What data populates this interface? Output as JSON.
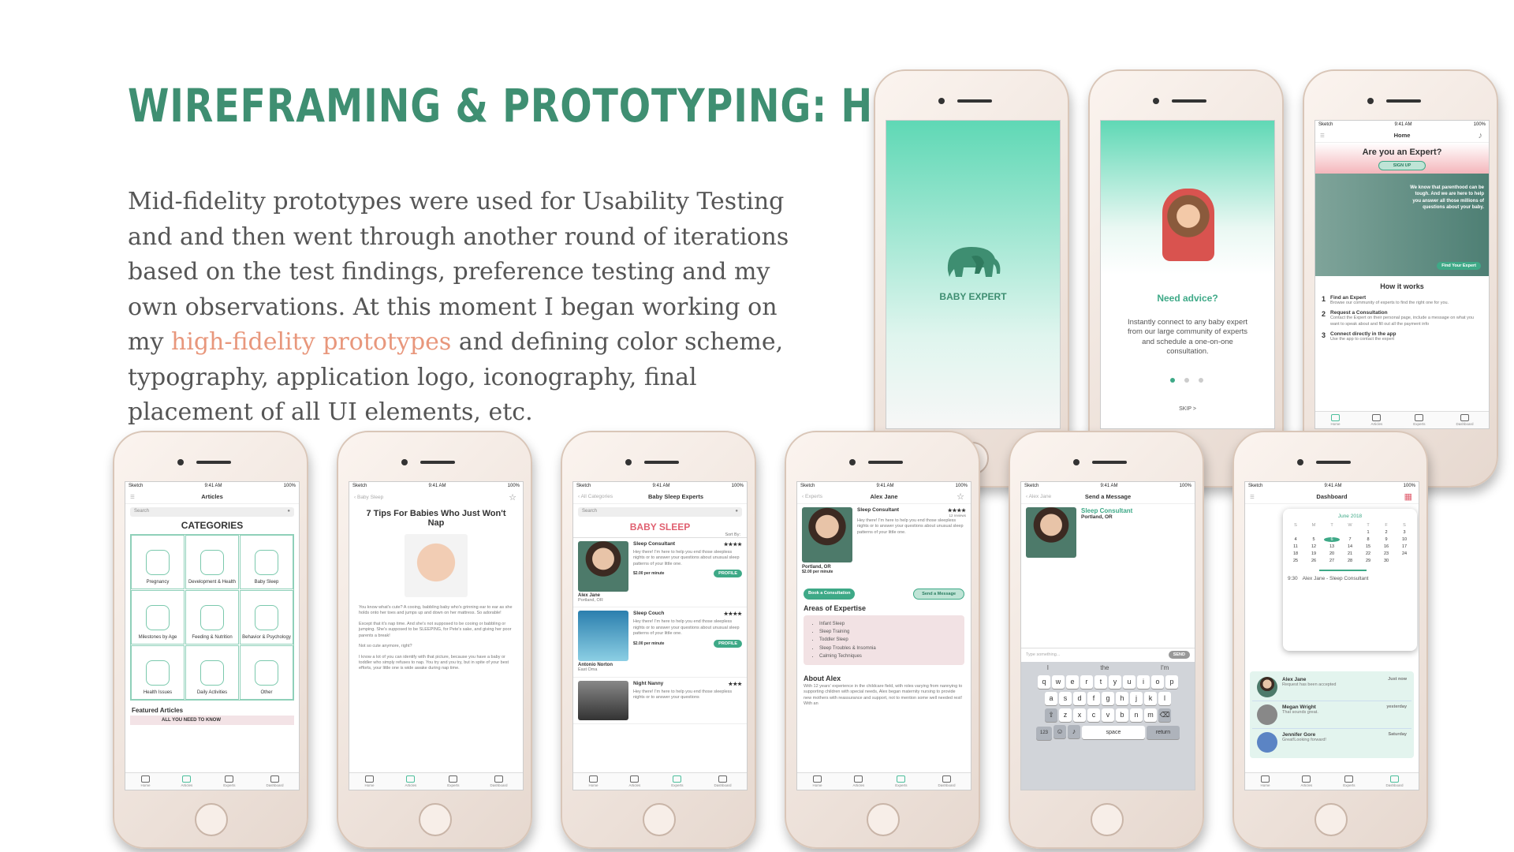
{
  "title": "WIREFRAMING & PROTOTYPING: HI-FI",
  "intro": {
    "part1": "Mid-fidelity prototypes were used for Usability Testing and and then went through another round of iterations based on the test findings, preference testing and my own observations. At this moment I began working on my ",
    "highlight": "high-fidelity prototypes",
    "part2": " and defining color scheme, typography, application logo, iconography, final placement of all UI elements, etc."
  },
  "colors": {
    "accent": "#3ea987",
    "title": "#3f8f72",
    "highlight": "#e8977c",
    "sleep_pink": "#e06070"
  },
  "status": {
    "carrier": "Sketch",
    "time": "9:41 AM",
    "battery": "100%"
  },
  "tabs": [
    "Home",
    "Articles",
    "Experts",
    "Dashboard"
  ],
  "splash": {
    "app_name": "BABY EXPERT"
  },
  "onboard": {
    "heading": "Need advice?",
    "text": "Instantly connect to any baby expert from our large community of experts and schedule a one-on-one consultation.",
    "skip": "SKIP >"
  },
  "home": {
    "nav": "Home",
    "question": "Are you an Expert?",
    "signup": "SIGN UP",
    "blurb": "We know that parenthood can be tough. And we are here to help you answer all those millions of questions about your baby.",
    "find": "Find Your Expert",
    "how": "How it works",
    "steps": [
      {
        "n": "1",
        "t": "Find an Expert",
        "d": "Browse our community of experts to find the right one for you."
      },
      {
        "n": "2",
        "t": "Request a Consultation",
        "d": "Contact the Expert on their personal page, include a message on what you want to speak about and fill out all the payment info"
      },
      {
        "n": "3",
        "t": "Connect directly in the app",
        "d": "Use the app to contact the expert"
      }
    ]
  },
  "articles": {
    "nav": "Articles",
    "search": "Search",
    "heading": "CATEGORIES",
    "categories": [
      "Pregnancy",
      "Development & Health",
      "Baby Sleep",
      "Milestones by Age",
      "Feeding & Nutrition",
      "Behavior & Psychology",
      "Health Issues",
      "Daily Activities",
      "Other"
    ],
    "featured": "Featured Articles",
    "featured_item": "ALL YOU NEED TO KNOW"
  },
  "article": {
    "back": "Baby Sleep",
    "title": "7 Tips For Babies Who Just Won't Nap",
    "p1": "You know what's cute? A cooing, babbling baby who's grinning ear to ear as she holds onto her toes and jumps up and down on her mattress. So adorable!",
    "p2": "Except that it's nap time. And she's not supposed to be cooing or babbling or jumping. She's supposed to be SLEEPING, for Pete's sake, and giving her poor parents a break!",
    "p3": "Not so cute anymore, right?",
    "p4": "I know a lot of you can identify with that picture, because you have a baby or toddler who simply refuses to nap. You try and you try, but in spite of your best efforts, your little one is wide awake during nap time."
  },
  "experts": {
    "back": "All Categories",
    "nav": "Baby Sleep Experts",
    "search": "Search",
    "heading": "BABY SLEEP",
    "sort": "Sort By:",
    "profile": "PROFILE",
    "list": [
      {
        "role": "Sleep Consultant",
        "name": "Alex Jane",
        "loc": "Portland, OR",
        "price": "$2.00 per minute",
        "rating": "★★★★",
        "bio": "Hey there! I'm here to help you end those sleepless nights or to answer your questions about unusual sleep patterns of your little one."
      },
      {
        "role": "Sleep Couch",
        "name": "Antonio Norton",
        "loc": "East Oma",
        "price": "$2.00 per minute",
        "rating": "★★★★",
        "bio": "Hey there! I'm here to help you end those sleepless nights or to answer your questions about unusual sleep patterns of your little one."
      },
      {
        "role": "Night Nanny",
        "name": "",
        "loc": "",
        "price": "",
        "rating": "★★★",
        "bio": "Hey there! I'm here to help you end those sleepless nights or to answer your questions"
      }
    ]
  },
  "profile": {
    "back": "Experts",
    "nav": "Alex Jane",
    "role": "Sleep Consultant",
    "rating": "★★★★",
    "reviews": "12 reviews",
    "bio": "Hey there! I'm here to help you end those sleepless nights or to answer your questions about unusual sleep patterns of your little one.",
    "loc": "Portland, OR",
    "price": "$2.00 per minute",
    "book": "Book a Consultation",
    "message": "Send a Message",
    "areas_title": "Areas of Expertise",
    "areas": [
      "Infant Sleep",
      "Sleep Training",
      "Toddler Sleep",
      "Sleep Troubles & Insomnia",
      "Calming Techniques"
    ],
    "about_title": "About Alex",
    "about": "With 12 years' experience in the childcare field, with roles varying from nannying to supporting children with special needs, Alex began maternity nursing to provide new mothers with reassurance and support, not to mention some well needed rest! With an"
  },
  "message": {
    "back": "Alex Jane",
    "nav": "Send a Message",
    "role": "Sleep Consultant",
    "loc": "Portland, OR",
    "placeholder": "Type something...",
    "send": "SEND",
    "suggest": [
      "I",
      "the",
      "I'm"
    ],
    "rows": [
      [
        "q",
        "w",
        "e",
        "r",
        "t",
        "y",
        "u",
        "i",
        "o",
        "p"
      ],
      [
        "a",
        "s",
        "d",
        "f",
        "g",
        "h",
        "j",
        "k",
        "l"
      ],
      [
        "z",
        "x",
        "c",
        "v",
        "b",
        "n",
        "m"
      ]
    ],
    "k123": "123",
    "space": "space",
    "return": "return"
  },
  "dashboard": {
    "nav": "Dashboard",
    "month": "June 2018",
    "weekdays": [
      "S",
      "M",
      "T",
      "W",
      "T",
      "F",
      "S"
    ],
    "days": [
      "",
      "",
      "",
      "",
      "1",
      "2",
      "3",
      "4",
      "5",
      "6",
      "7",
      "8",
      "9",
      "10",
      "11",
      "12",
      "13",
      "14",
      "15",
      "16",
      "17",
      "18",
      "19",
      "20",
      "21",
      "22",
      "23",
      "24",
      "25",
      "26",
      "27",
      "28",
      "29",
      "30"
    ],
    "selected": "6",
    "event_time": "9:30",
    "event": "Alex Jane - Sleep Consultant",
    "notes": [
      {
        "name": "Alex Jane",
        "time": "Just now",
        "text": "Request has been accepted"
      },
      {
        "name": "Megan Wright",
        "time": "yesterday",
        "text": "That sounds great."
      },
      {
        "name": "Jennifer Gore",
        "time": "Saturday",
        "text": "Great!Looking forward!"
      }
    ]
  }
}
